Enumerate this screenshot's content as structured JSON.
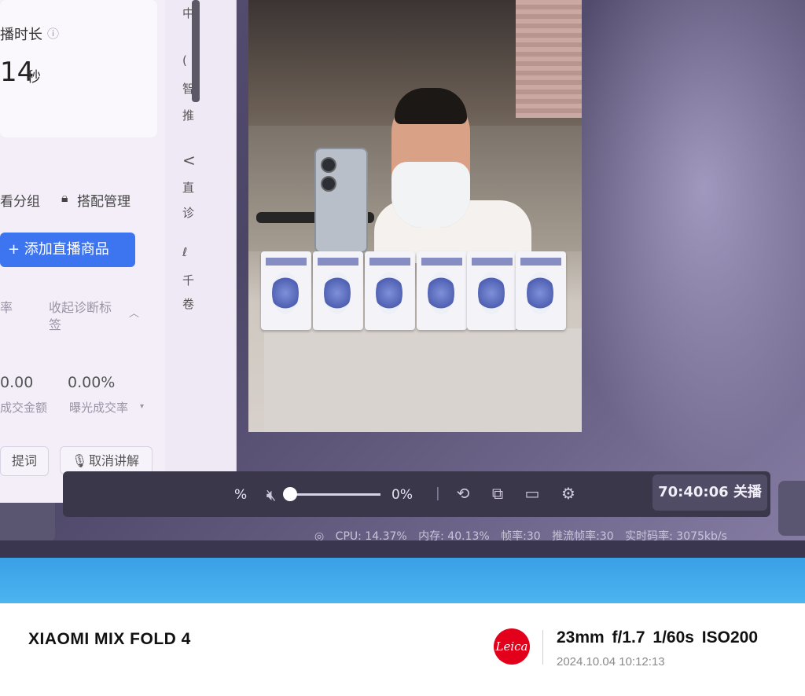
{
  "left_panel": {
    "duration_label": "播时长",
    "duration_value": "14",
    "duration_unit": "秒",
    "tab_group": "看分组",
    "tab_bundle": "搭配管理",
    "add_product_button": "+ 添加直播商品",
    "col_fragment": "率",
    "collapse_tags": "收起诊断标",
    "collapse_tags_line2": "签",
    "stat_amount_value": "0.00",
    "stat_amount_label": "成交金额",
    "stat_rate_value": "0.00%",
    "stat_rate_label": "曝光成交率",
    "prompt_button": "提词",
    "cancel_explain_button": "取消讲解"
  },
  "side_column": {
    "chars": [
      "中",
      "(",
      "智",
      "推",
      "<",
      "直",
      "诊",
      "",
      "千",
      "卷"
    ]
  },
  "controls": {
    "volume_left": "%",
    "volume_right": "0%",
    "end_button": "70:40:06 关播"
  },
  "status": {
    "cpu": "CPU: 14.37%",
    "memory": "内存: 40.13%",
    "fps": "帧率:30",
    "push_fps": "推流帧率:30",
    "bitrate": "实时码率: 3075kb/s"
  },
  "footer": {
    "device": "XIAOMI MIX FOLD 4",
    "brand_logo": "Leica",
    "exif": "23mm  f/1.7  1/60s  ISO200",
    "datetime": "2024.10.04 10:12:13"
  },
  "colors": {
    "accent_blue": "#3d74f0",
    "leica_red": "#e2001a"
  }
}
